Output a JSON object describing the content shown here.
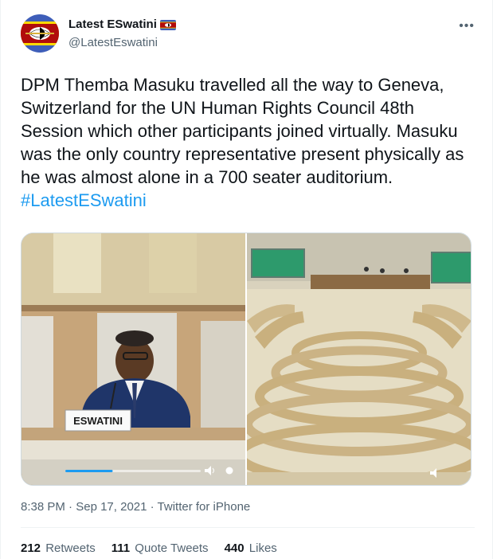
{
  "author": {
    "name": "Latest ESwatini",
    "handle": "@LatestEswatini"
  },
  "tweet": {
    "text": "DPM Themba Masuku travelled all the way to Geneva, Switzerland for the UN Human Rights Council 48th Session which other participants joined virtually. Masuku was the only country representative present physically as he was almost alone in a 700 seater auditorium.",
    "hashtag": "#LatestESwatini"
  },
  "media": {
    "nameplate": "ESWATINI",
    "video_progress": 0.35
  },
  "meta": {
    "time": "8:38 PM",
    "date": "Sep 17, 2021",
    "source": "Twitter for iPhone",
    "separator": " · "
  },
  "stats": {
    "retweets_count": "212",
    "retweets_label": "Retweets",
    "quotes_count": "111",
    "quotes_label": "Quote Tweets",
    "likes_count": "440",
    "likes_label": "Likes"
  },
  "colors": {
    "accent": "#1d9bf0",
    "text": "#0f1419",
    "secondary": "#536471",
    "border": "#eff3f4"
  },
  "icons": {
    "more": "more-icon",
    "flag": "eswatini-flag-icon",
    "avatar": "avatar-logo"
  }
}
